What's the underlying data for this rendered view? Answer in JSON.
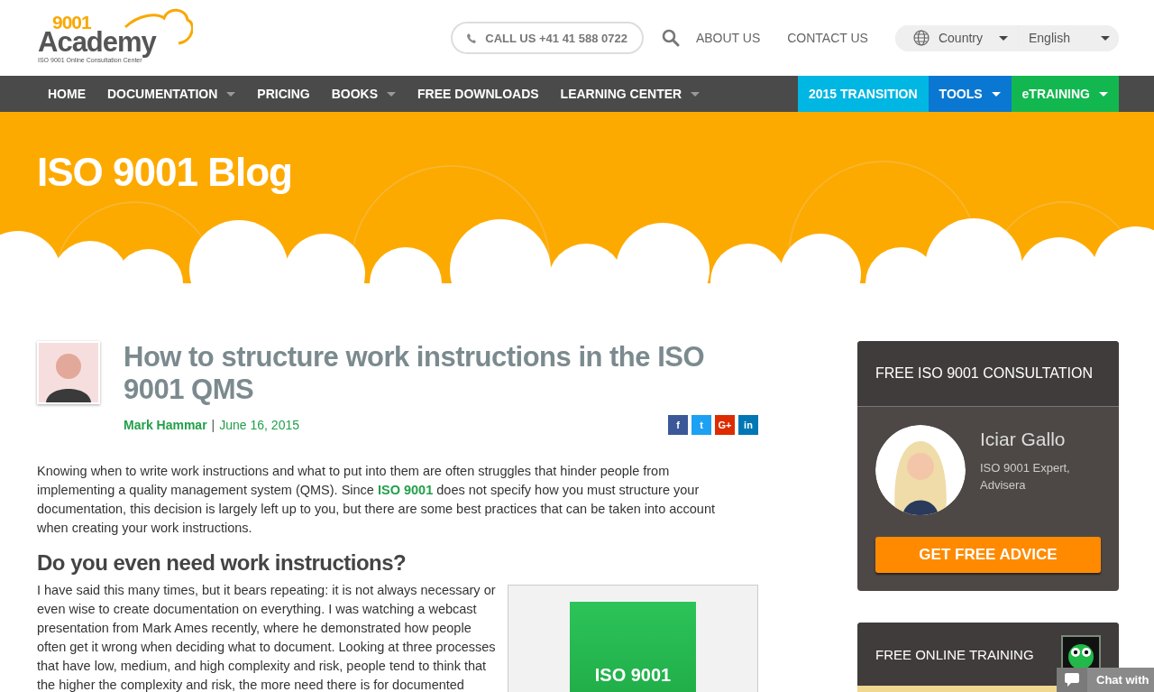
{
  "logo": {
    "number": "9001",
    "name": "Academy",
    "tagline": "ISO 9001 Online Consultation Center"
  },
  "header": {
    "call_button": "CALL US +41 41 588 0722",
    "links": [
      "ABOUT US",
      "CONTACT US"
    ],
    "country": "Country",
    "language": "English"
  },
  "nav": [
    {
      "label": "HOME",
      "has_menu": false
    },
    {
      "label": "DOCUMENTATION",
      "has_menu": true
    },
    {
      "label": "PRICING",
      "has_menu": false
    },
    {
      "label": "BOOKS",
      "has_menu": true
    },
    {
      "label": "FREE DOWNLOADS",
      "has_menu": false
    },
    {
      "label": "LEARNING CENTER",
      "has_menu": true
    }
  ],
  "nav_right": [
    {
      "label": "2015 TRANSITION",
      "has_menu": false,
      "color": "#00b6e3"
    },
    {
      "label": "TOOLS",
      "has_menu": true,
      "color": "#0a78d2"
    },
    {
      "label": "eTRAINING",
      "has_menu": true,
      "color": "#12b84f"
    }
  ],
  "hero": {
    "title": "ISO 9001 Blog"
  },
  "article": {
    "title": "How to structure work instructions in the ISO 9001 QMS",
    "author": "Mark Hammar",
    "separator": "|",
    "date": "June 16, 2015",
    "share": [
      {
        "label": "f",
        "color": "#3b5998"
      },
      {
        "label": "t",
        "color": "#1da1f2"
      },
      {
        "label": "G+",
        "color": "#dd2c00"
      },
      {
        "label": "in",
        "color": "#0077b5"
      }
    ],
    "intro": [
      {
        "text": "Knowing when to write work instructions and what to put into them are often struggles that hinder people from implementing a quality management system (QMS). Since ",
        "link": false
      },
      {
        "text": "ISO 9001",
        "link": true
      },
      {
        "text": " does not specify how you must structure your documentation, this decision is largely left up to you, but there are some best practices that can be taken into account when creating your work instructions.",
        "link": false
      }
    ],
    "heading": "Do you even need work instructions?",
    "paragraph": "I have said this many times, but it bears repeating: it is not always necessary or even wise to create documentation on everything. I was watching a webcast presentation from Mark Ames recently, where he demonstrated how people often get it wrong when deciding what to document. Looking at three processes that have low, medium, and high complexity and risk, people tend to think that the higher the complexity and risk, the more need there is for documented",
    "product_label": "ISO 9001"
  },
  "sidebar": {
    "consultation": {
      "title": "FREE ISO 9001 CONSULTATION",
      "name": "Iciar Gallo",
      "role": "ISO 9001 Expert, Advisera",
      "button": "GET FREE ADVICE"
    },
    "training": {
      "title": "FREE ONLINE TRAINING"
    }
  },
  "chat": {
    "label": "Chat with"
  }
}
